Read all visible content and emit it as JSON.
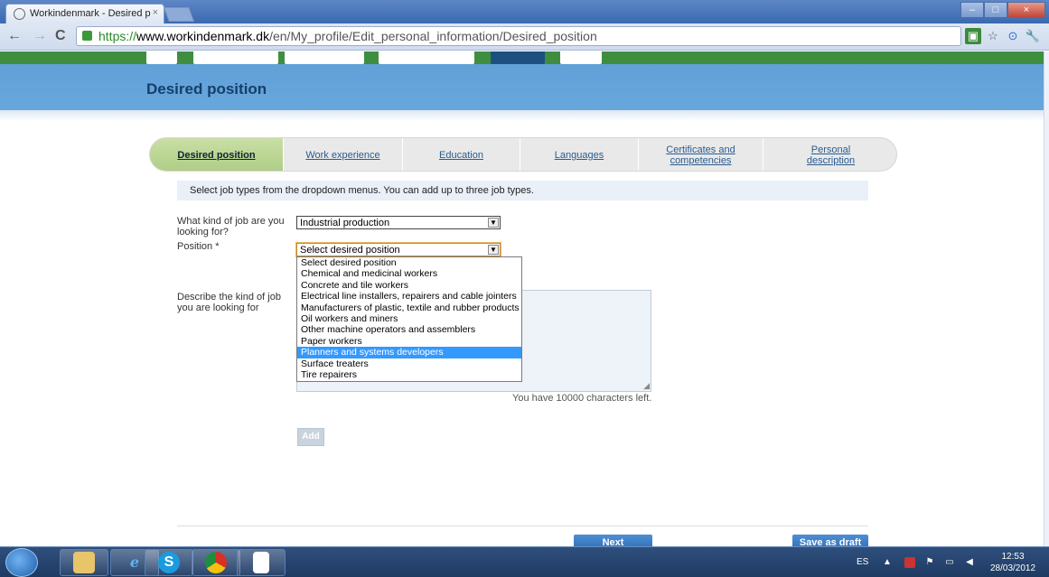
{
  "browser": {
    "tab_title": "Workindenmark - Desired p",
    "tab_close": "×",
    "url_proto": "https://",
    "url_host": "www.workindenmark.dk",
    "url_path": "/en/My_profile/Edit_personal_information/Desired_position",
    "back": "←",
    "forward": "→",
    "reload": "C",
    "star": "☆",
    "wrench": "🔧"
  },
  "page": {
    "title": "Desired position",
    "steps": [
      {
        "label": "Desired position"
      },
      {
        "label": "Work experience"
      },
      {
        "label": "Education"
      },
      {
        "label": "Languages"
      },
      {
        "label": "Certificates and competencies"
      },
      {
        "label": "Personal description"
      }
    ],
    "info": "Select job types from the dropdown menus. You can add up to three job types.",
    "job_kind_label": "What kind of job are you looking for?",
    "job_kind_value": "Industrial production",
    "position_label": "Position *",
    "position_value": "Select desired position",
    "describe_label": "Describe the kind of job you are looking for",
    "chars_left": "You have 10000 characters left.",
    "dropdown_options": [
      "Select desired position",
      "Chemical and medicinal workers",
      "Concrete and tile workers",
      "Electrical line installers, repairers and cable jointers",
      "Manufacturers of plastic, textile and rubber products",
      "Oil workers and miners",
      "Other machine operators and assemblers",
      "Paper workers",
      "Planners and systems developers",
      "Surface treaters",
      "Tire repairers"
    ],
    "highlighted_option": "Planners and systems developers",
    "add_button": "Add",
    "next_button": "Next",
    "draft_button": "Save as draft"
  },
  "taskbar": {
    "skype": "S",
    "lang": "ES",
    "time": "12:53",
    "date": "28/03/2012"
  },
  "colors": {
    "banner": "#68a7dc",
    "active_step": "#aecd84",
    "button": "#2d6db7",
    "highlight": "#3399ff"
  }
}
